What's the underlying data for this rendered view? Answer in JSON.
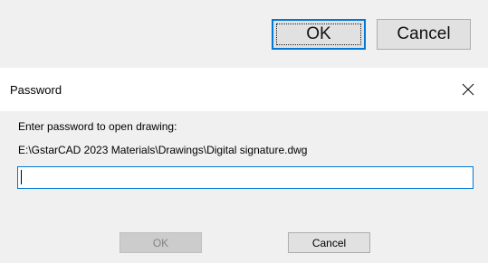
{
  "background_dialog": {
    "ok_label": "OK",
    "cancel_label": "Cancel"
  },
  "password_dialog": {
    "title": "Password",
    "close_icon": "close-icon",
    "prompt": "Enter password to open drawing:",
    "file_path": "E:\\GstarCAD 2023 Materials\\Drawings\\Digital signature.dwg",
    "password_value": "",
    "ok_label": "OK",
    "ok_enabled": false,
    "cancel_label": "Cancel"
  },
  "colors": {
    "accent": "#0078d7",
    "window_bg": "#f0f0f0",
    "titlebar_bg": "#ffffff",
    "disabled_text": "#838383"
  }
}
